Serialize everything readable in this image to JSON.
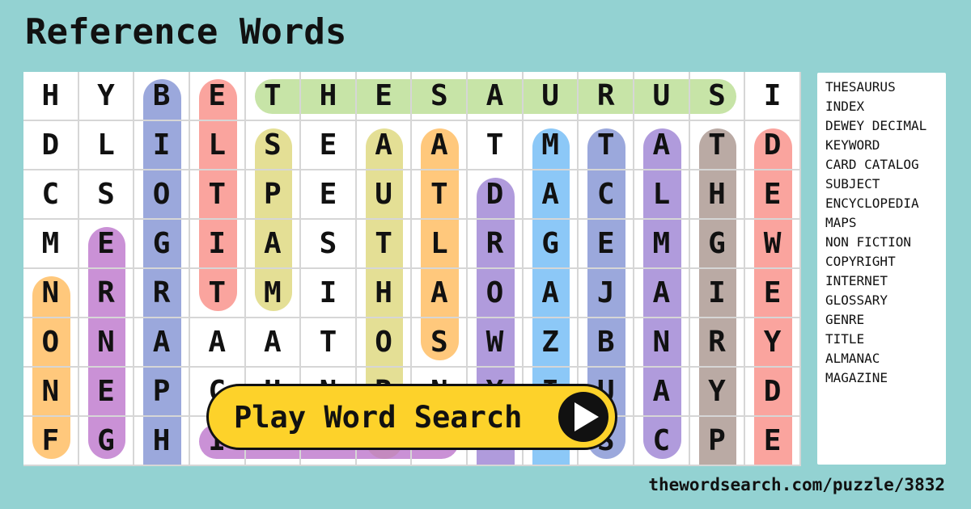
{
  "title": "Reference Words",
  "grid": {
    "rows": [
      [
        "H",
        "Y",
        "B",
        "E",
        "T",
        "H",
        "E",
        "S",
        "A",
        "U",
        "R",
        "U",
        "S",
        "I"
      ],
      [
        "D",
        "L",
        "I",
        "L",
        "S",
        "E",
        "A",
        "A",
        "T",
        "M",
        "T",
        "A",
        "T",
        "D"
      ],
      [
        "C",
        "S",
        "O",
        "T",
        "P",
        "E",
        "U",
        "T",
        "D",
        "A",
        "C",
        "L",
        "H",
        "E"
      ],
      [
        "M",
        "E",
        "G",
        "I",
        "A",
        "S",
        "T",
        "L",
        "R",
        "G",
        "E",
        "M",
        "G",
        "W"
      ],
      [
        "N",
        "R",
        "R",
        "T",
        "M",
        "I",
        "H",
        "A",
        "O",
        "A",
        "J",
        "A",
        "I",
        "E"
      ],
      [
        "O",
        "N",
        "A",
        "A",
        "A",
        "T",
        "O",
        "S",
        "W",
        "Z",
        "B",
        "N",
        "R",
        "Y"
      ],
      [
        "N",
        "E",
        "P",
        "C",
        "H",
        "N",
        "R",
        "N",
        "Y",
        "I",
        "U",
        "A",
        "Y",
        "D"
      ],
      [
        "F",
        "G",
        "H",
        "I",
        "N",
        "D",
        "E",
        "X",
        "E",
        "N",
        "S",
        "C",
        "P",
        "E"
      ]
    ],
    "highlights": [
      {
        "word": "THESAURUS",
        "row": 0,
        "col": 4,
        "dir": "h",
        "len": 9,
        "color": "#b7dc8e"
      },
      {
        "word": "BIOGRAPHY",
        "row": 0,
        "col": 2,
        "dir": "v",
        "len": 9,
        "color": "#7f8fd2"
      },
      {
        "word": "ELTIT",
        "row": 0,
        "col": 3,
        "dir": "v",
        "len": 5,
        "color": "#f88a83"
      },
      {
        "word": "SPAM",
        "row": 1,
        "col": 4,
        "dir": "v",
        "len": 4,
        "color": "#dcd677"
      },
      {
        "word": "AUTHOR",
        "row": 1,
        "col": 6,
        "dir": "v",
        "len": 7,
        "color": "#dcd677"
      },
      {
        "word": "ATLAS",
        "row": 1,
        "col": 7,
        "dir": "v",
        "len": 5,
        "color": "#ffb957"
      },
      {
        "word": "MAGAZINE",
        "row": 1,
        "col": 9,
        "dir": "v",
        "len": 8,
        "color": "#6cb8f5"
      },
      {
        "word": "SUBJECT",
        "row": 1,
        "col": 10,
        "dir": "v",
        "len": 7,
        "color": "#7f8fd2"
      },
      {
        "word": "ALMANAC",
        "row": 1,
        "col": 11,
        "dir": "v",
        "len": 7,
        "color": "#9a7fd2"
      },
      {
        "word": "THGIRYPOC",
        "row": 1,
        "col": 12,
        "dir": "v",
        "len": 8,
        "color": "#a6928a"
      },
      {
        "word": "DEWEY DECIMAL",
        "row": 1,
        "col": 13,
        "dir": "v",
        "len": 8,
        "color": "#f88a83"
      },
      {
        "word": "KEYWORD",
        "row": 2,
        "col": 8,
        "dir": "v",
        "len": 7,
        "color": "#9a7fd2"
      },
      {
        "word": "GENRE",
        "row": 3,
        "col": 1,
        "dir": "v",
        "len": 5,
        "color": "#bb72ca"
      },
      {
        "word": "NON FICTION",
        "row": 4,
        "col": 0,
        "dir": "v",
        "len": 4,
        "color": "#ffb957"
      },
      {
        "word": "INDEX",
        "row": 7,
        "col": 3,
        "dir": "h",
        "len": 5,
        "color": "#bb72ca"
      }
    ]
  },
  "word_list": [
    "THESAURUS",
    "INDEX",
    "DEWEY DECIMAL",
    "KEYWORD",
    "CARD CATALOG",
    "SUBJECT",
    "ENCYCLOPEDIA",
    "MAPS",
    "NON FICTION",
    "COPYRIGHT",
    "INTERNET",
    "GLOSSARY",
    "GENRE",
    "TITLE",
    "ALMANAC",
    "MAGAZINE"
  ],
  "play_button": {
    "label": "Play Word Search",
    "icon": "play-icon"
  },
  "footer_url": "thewordsearch.com/puzzle/3832"
}
